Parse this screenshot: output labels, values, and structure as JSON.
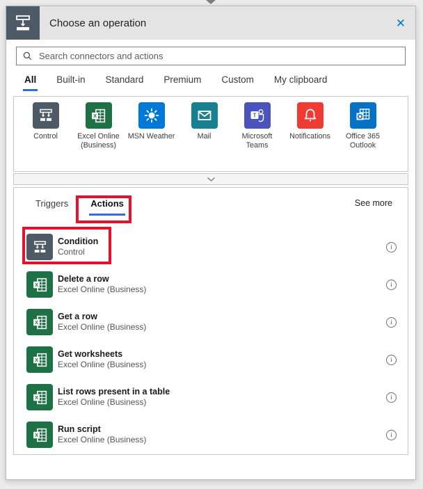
{
  "dialog": {
    "title": "Choose an operation"
  },
  "search": {
    "placeholder": "Search connectors and actions"
  },
  "category_tabs": [
    {
      "label": "All",
      "selected": true
    },
    {
      "label": "Built-in",
      "selected": false
    },
    {
      "label": "Standard",
      "selected": false
    },
    {
      "label": "Premium",
      "selected": false
    },
    {
      "label": "Custom",
      "selected": false
    },
    {
      "label": "My clipboard",
      "selected": false
    }
  ],
  "connectors": [
    {
      "name": "Control",
      "icon": "control-icon",
      "color": "#4e5a65"
    },
    {
      "name": "Excel Online (Business)",
      "icon": "excel-icon",
      "color": "#1e7145"
    },
    {
      "name": "MSN Weather",
      "icon": "weather-sun-icon",
      "color": "#0078d7"
    },
    {
      "name": "Mail",
      "icon": "mail-envelope-icon",
      "color": "#18808f"
    },
    {
      "name": "Microsoft Teams",
      "icon": "teams-icon",
      "color": "#4b53bc"
    },
    {
      "name": "Notifications",
      "icon": "notification-bell-icon",
      "color": "#ee3c34"
    },
    {
      "name": "Office 365 Outlook",
      "icon": "outlook-icon",
      "color": "#0572c6"
    }
  ],
  "results_panel": {
    "tabs": [
      {
        "label": "Triggers",
        "selected": false,
        "annotated": false
      },
      {
        "label": "Actions",
        "selected": true,
        "annotated": true
      }
    ],
    "see_more": "See more",
    "operations": [
      {
        "title": "Condition",
        "subtitle": "Control",
        "icon": "control-icon",
        "color": "#4e5a65",
        "annotated": true
      },
      {
        "title": "Delete a row",
        "subtitle": "Excel Online (Business)",
        "icon": "excel-icon",
        "color": "#1e7145",
        "annotated": false
      },
      {
        "title": "Get a row",
        "subtitle": "Excel Online (Business)",
        "icon": "excel-icon",
        "color": "#1e7145",
        "annotated": false
      },
      {
        "title": "Get worksheets",
        "subtitle": "Excel Online (Business)",
        "icon": "excel-icon",
        "color": "#1e7145",
        "annotated": false
      },
      {
        "title": "List rows present in a table",
        "subtitle": "Excel Online (Business)",
        "icon": "excel-icon",
        "color": "#1e7145",
        "annotated": false
      },
      {
        "title": "Run script",
        "subtitle": "Excel Online (Business)",
        "icon": "excel-icon",
        "color": "#1e7145",
        "annotated": false
      }
    ]
  },
  "colors": {
    "accent": "#0078d4",
    "tab_underline": "#2e6fd9",
    "annotation": "#e8112d"
  }
}
